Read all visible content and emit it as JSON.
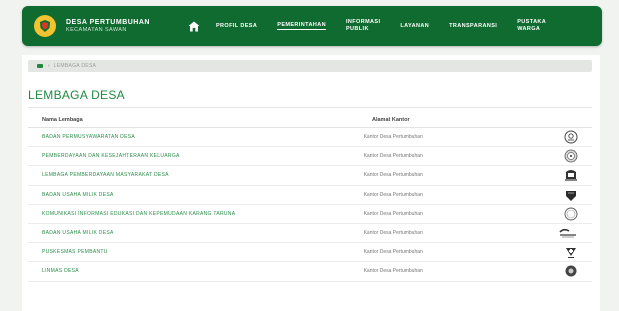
{
  "header": {
    "title": "DESA PERTUMBUHAN",
    "subtitle": "KECAMATAN SAWAN"
  },
  "nav": [
    {
      "label": "PROFIL DESA",
      "active": false
    },
    {
      "label": "PEMERINTAHAN",
      "active": true
    },
    {
      "label": "INFORMASI\nPUBLIK",
      "active": false
    },
    {
      "label": "LAYANAN",
      "active": false
    },
    {
      "label": "TRANSPARANSI",
      "active": false
    },
    {
      "label": "PUSTAKA\nWARGA",
      "active": false
    }
  ],
  "breadcrumb": {
    "current": "LEMBAGA DESA"
  },
  "page_title": "LEMBAGA DESA",
  "table": {
    "headers": {
      "name": "Nama Lembaga",
      "address": "Alamat Kantor"
    },
    "rows": [
      {
        "name": "BADAN PERMUSYAWARATAN DESA",
        "address": "Kantor Desa Pertumbuhan",
        "logo": "bpd-emblem-icon"
      },
      {
        "name": "PEMBERDAYAAN DAN KESEJAHTERAAN KELUARGA",
        "address": "Kantor Desa Pertumbuhan",
        "logo": "pkk-emblem-icon"
      },
      {
        "name": "LEMBAGA PEMBERDAYAAN MASYARAKAT DESA",
        "address": "Kantor Desa Pertumbuhan",
        "logo": "lpmd-emblem-icon"
      },
      {
        "name": "BADAN USAHA MILIK DESA",
        "address": "Kantor Desa Pertumbuhan",
        "logo": "bumdes-emblem-icon"
      },
      {
        "name": "KOMUNIKASI INFORMASI EDUKASI DAN KEPEMUDAAN KARANG TARUNA",
        "address": "Kantor Desa Pertumbuhan",
        "logo": "karang-taruna-emblem-icon"
      },
      {
        "name": "BADAN USAHA MILIK DESA",
        "address": "Kantor Desa Pertumbuhan",
        "logo": "bumdes-logo-icon"
      },
      {
        "name": "PUSKESMAS PEMBANTU",
        "address": "Kantor Desa Pertumbuhan",
        "logo": "health-emblem-icon"
      },
      {
        "name": "LINMAS DESA",
        "address": "Kantor Desa Pertumbuhan",
        "logo": "linmas-emblem-icon"
      }
    ]
  },
  "colors": {
    "header_green": "#0f6b2f",
    "accent_green": "#1f8a41",
    "logo_gold": "#f2c230"
  }
}
